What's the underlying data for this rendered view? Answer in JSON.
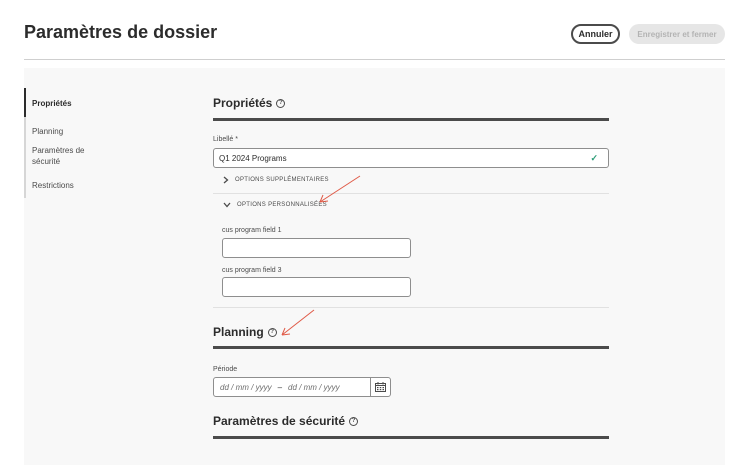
{
  "header": {
    "title": "Paramètres de dossier",
    "cancel_label": "Annuler",
    "save_label": "Enregistrer et fermer"
  },
  "nav": {
    "items": [
      {
        "label": "Propriétés",
        "active": true
      },
      {
        "label": "Planning",
        "active": false
      },
      {
        "label": "Paramètres de sécurité",
        "active": false
      },
      {
        "label": "Restrictions",
        "active": false
      }
    ]
  },
  "properties": {
    "title": "Propriétés",
    "label_field": {
      "label": "Libellé",
      "required_mark": "*",
      "value": "Q1 2024 Programs"
    },
    "additional_options_label": "OPTIONS SUPPLÉMENTAIRES",
    "custom_options_label": "OPTIONS PERSONNALISÉES",
    "custom_fields": [
      {
        "label": "cus program field 1",
        "value": ""
      },
      {
        "label": "cus program field 3",
        "value": ""
      }
    ]
  },
  "planning": {
    "title": "Planning",
    "period_label": "Période",
    "start_placeholder": "dd / mm / yyyy",
    "separator": "–",
    "end_placeholder": "dd / mm / yyyy"
  },
  "security": {
    "title": "Paramètres de sécurité"
  },
  "colors": {
    "accent_dark": "#2c2c2c",
    "valid_check": "#2d9d78",
    "annotation_arrow": "#e05a47"
  }
}
